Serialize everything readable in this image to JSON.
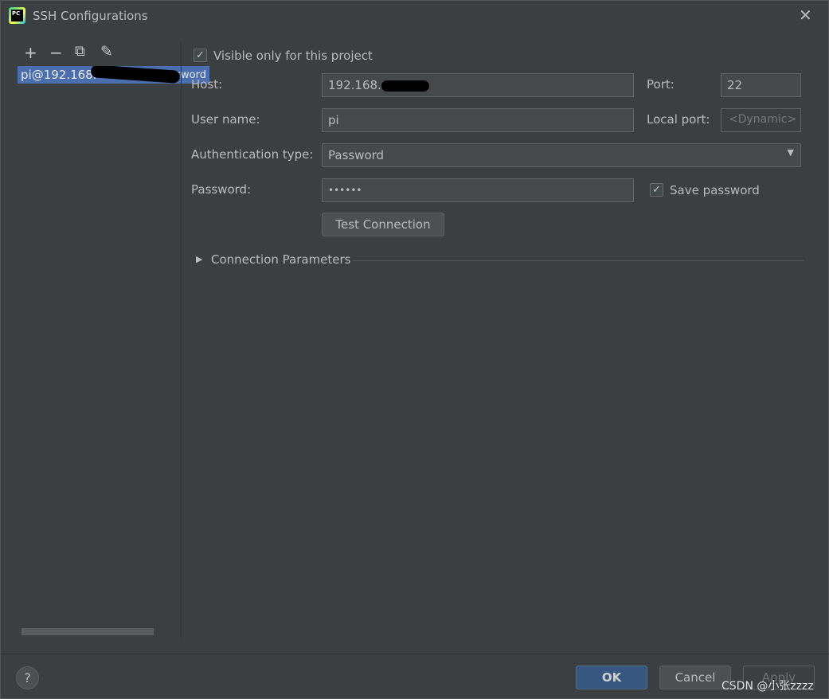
{
  "window": {
    "title": "SSH Configurations",
    "logo_text": "PC"
  },
  "toolbar": {
    "add": "+",
    "remove": "−",
    "copy": "⧉",
    "edit": "✎"
  },
  "list": {
    "items": [
      {
        "label_prefix": "pi@192.168.",
        "label_suffix": "assword"
      }
    ]
  },
  "form": {
    "visible_only_label": "Visible only for this project",
    "visible_only_checked": true,
    "host_label": "Host:",
    "host_value": "192.168.",
    "port_label": "Port:",
    "port_value": "22",
    "user_label": "User name:",
    "user_value": "pi",
    "local_port_label": "Local port:",
    "local_port_placeholder": "<Dynamic>",
    "auth_label": "Authentication type:",
    "auth_value": "Password",
    "password_label": "Password:",
    "password_value": "••••••",
    "save_password_label": "Save password",
    "save_password_checked": true,
    "test_connection": "Test Connection",
    "connection_params": "Connection Parameters"
  },
  "footer": {
    "help": "?",
    "ok": "OK",
    "cancel": "Cancel",
    "apply": "Apply",
    "watermark": "CSDN @小张zzzz"
  }
}
